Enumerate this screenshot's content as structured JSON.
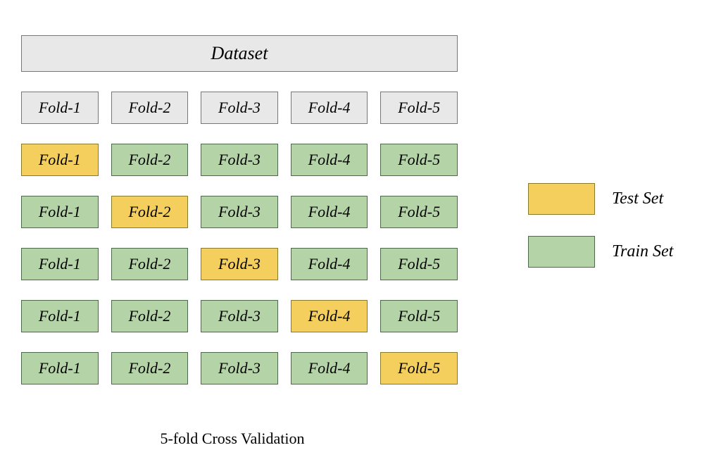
{
  "title": "Dataset",
  "caption": "5-fold Cross Validation",
  "folds": [
    "Fold-1",
    "Fold-2",
    "Fold-3",
    "Fold-4",
    "Fold-5"
  ],
  "legend": {
    "test": {
      "label": "Test Set",
      "color": "yellow"
    },
    "train": {
      "label": "Train Set",
      "color": "green"
    }
  },
  "chart_data": {
    "type": "table",
    "title": "5-fold Cross Validation",
    "n_folds": 5,
    "rows": [
      {
        "role": "header",
        "cells": [
          "gray",
          "gray",
          "gray",
          "gray",
          "gray"
        ]
      },
      {
        "role": "split",
        "test_index": 0,
        "cells": [
          "yellow",
          "green",
          "green",
          "green",
          "green"
        ]
      },
      {
        "role": "split",
        "test_index": 1,
        "cells": [
          "green",
          "yellow",
          "green",
          "green",
          "green"
        ]
      },
      {
        "role": "split",
        "test_index": 2,
        "cells": [
          "green",
          "green",
          "yellow",
          "green",
          "green"
        ]
      },
      {
        "role": "split",
        "test_index": 3,
        "cells": [
          "green",
          "green",
          "green",
          "yellow",
          "green"
        ]
      },
      {
        "role": "split",
        "test_index": 4,
        "cells": [
          "green",
          "green",
          "green",
          "green",
          "yellow"
        ]
      }
    ],
    "color_meaning": {
      "yellow": "Test Set",
      "green": "Train Set",
      "gray": "Fold label"
    }
  }
}
